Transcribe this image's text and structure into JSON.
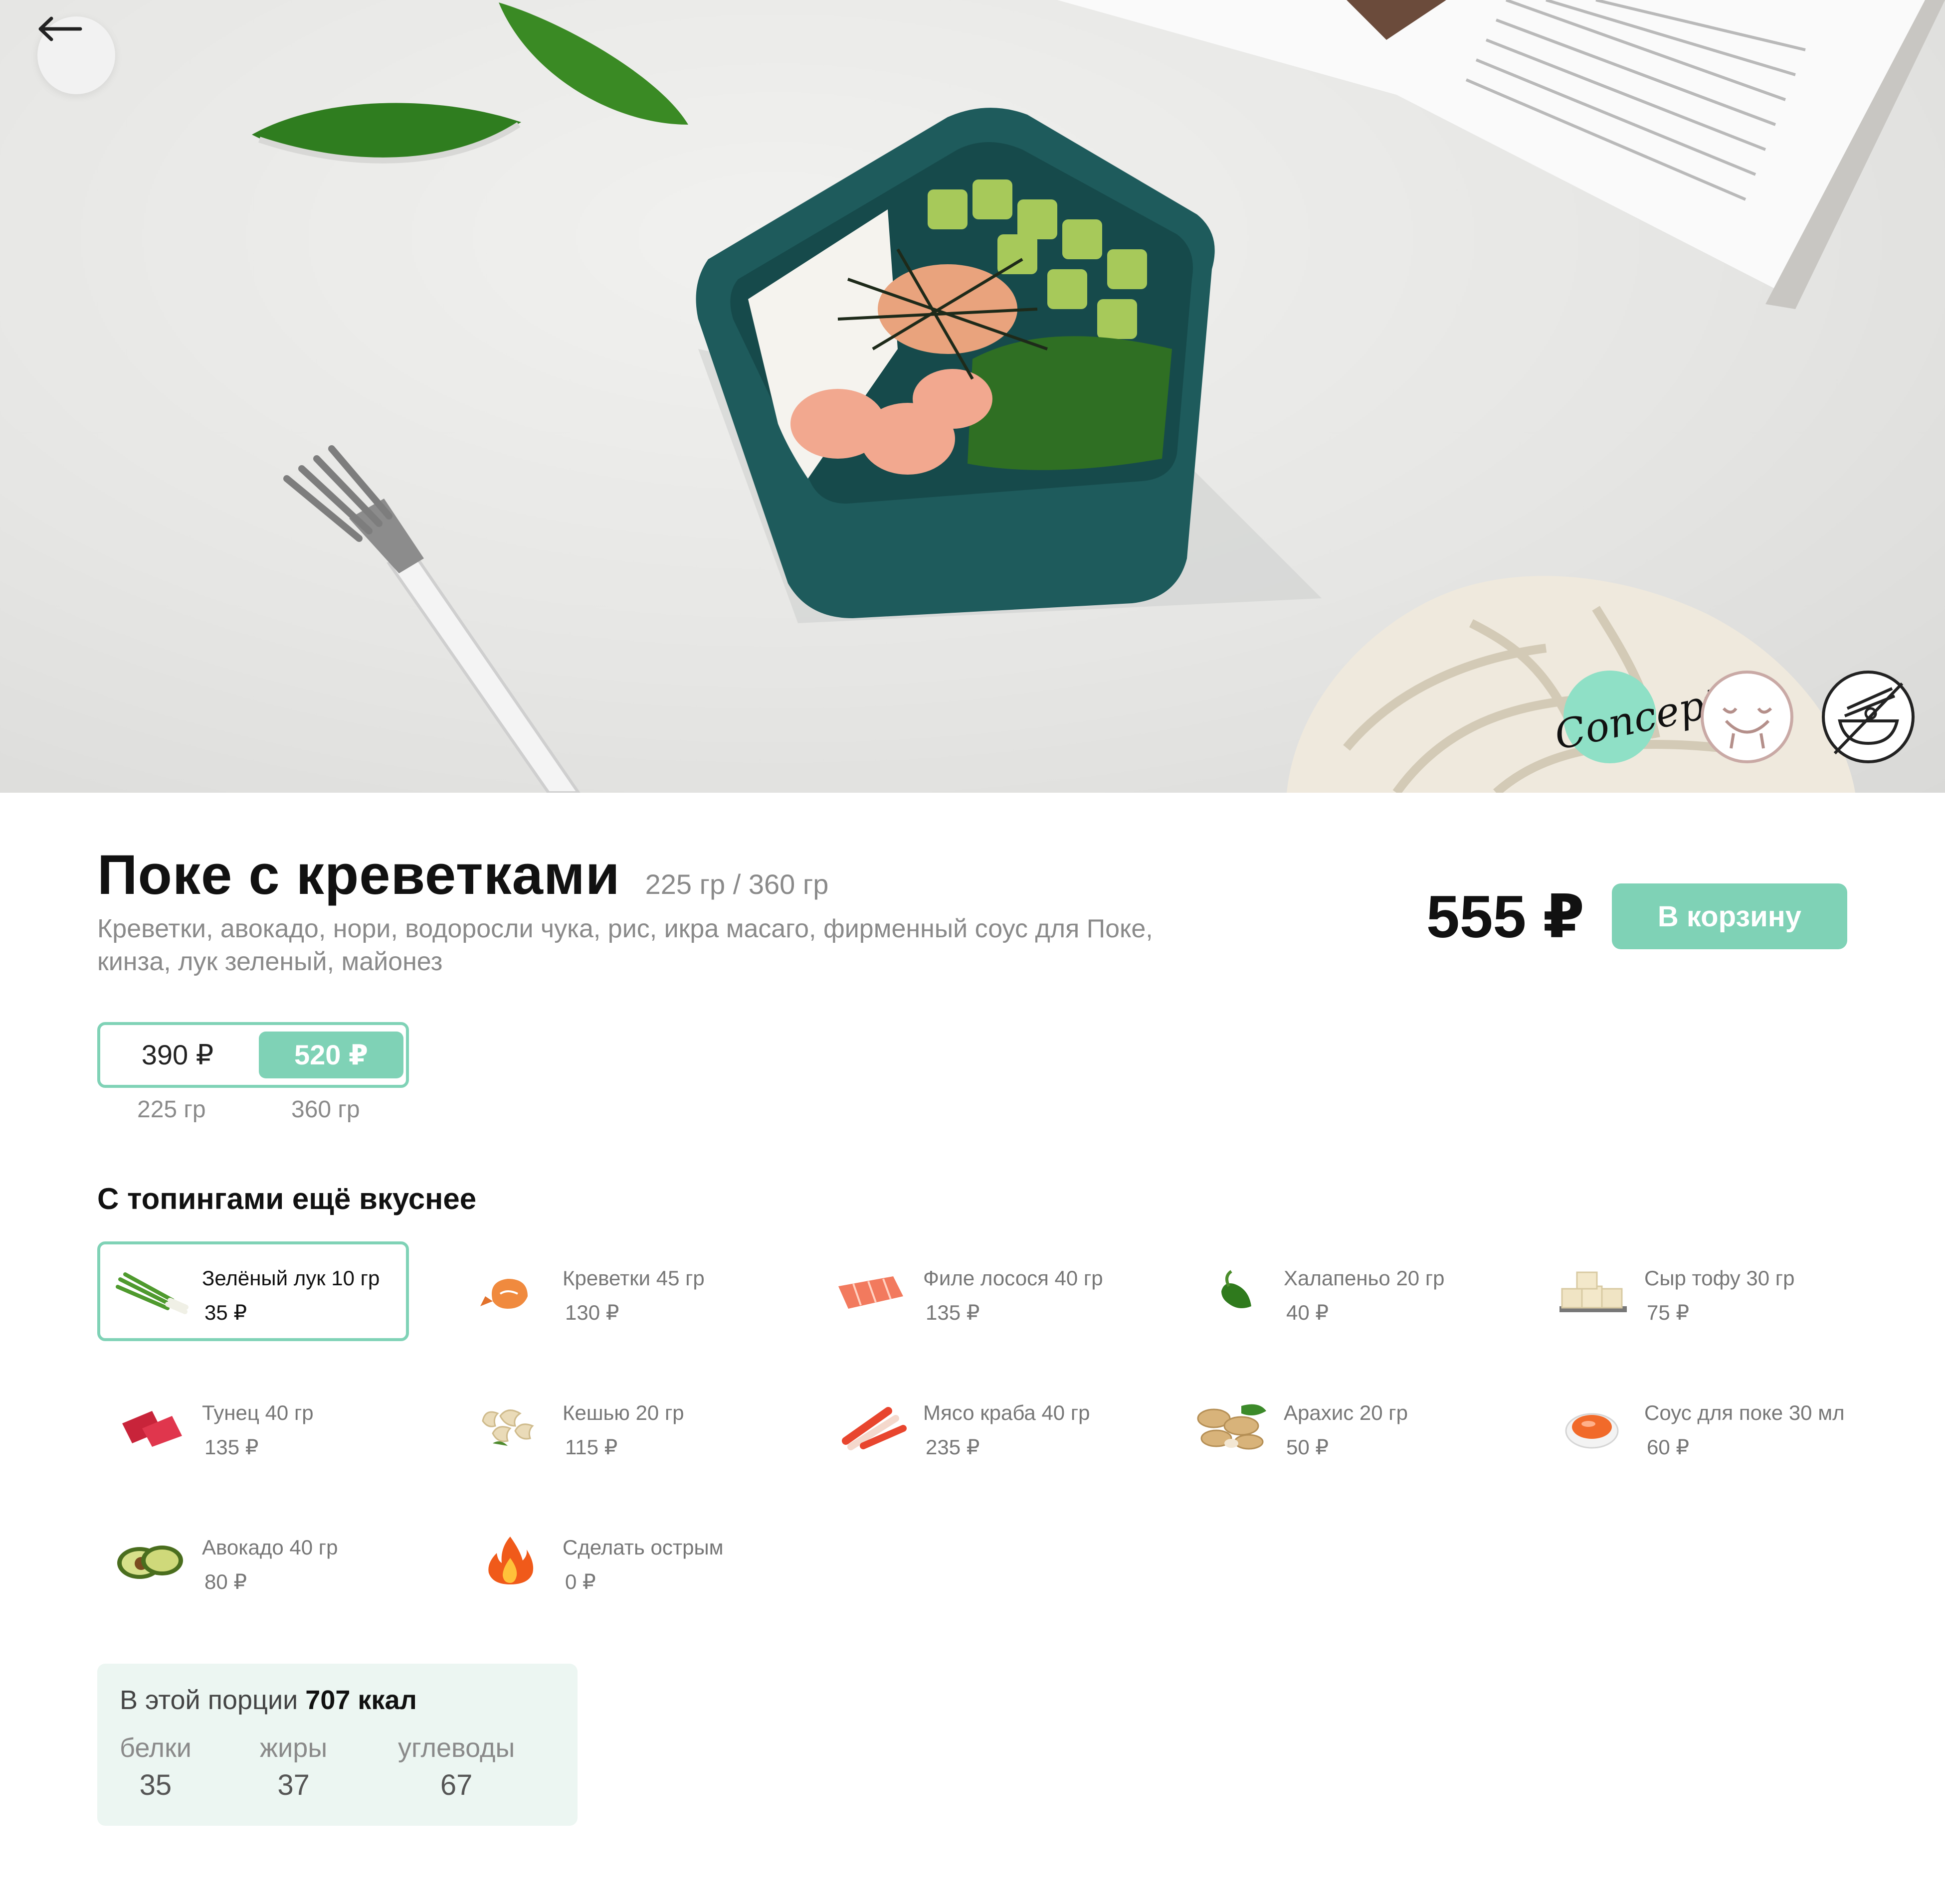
{
  "hero": {
    "badges": [
      {
        "name": "concept",
        "text": "Concept",
        "color": "#8fe0c6"
      },
      {
        "name": "face-icon"
      },
      {
        "name": "bowl-icon"
      }
    ]
  },
  "product": {
    "title": "Поке с креветками",
    "weights": "225 гр / 360 гр",
    "description": "Креветки, авокадо, нори, водоросли чука, рис, икра масаго, фирменный соус для Поке, кинза, лук зеленый, майонез",
    "price": "555 ₽",
    "cart_label": "В корзину"
  },
  "sizes": [
    {
      "price": "390 ₽",
      "weight": "225 гр",
      "selected": false
    },
    {
      "price": "520 ₽",
      "weight": "360 гр",
      "selected": true
    }
  ],
  "toppings_title": "С топингами ещё вкуснее",
  "toppings": [
    {
      "name": "Зелёный лук 10 гр",
      "price": "35 ₽",
      "icon": "green-onion-icon",
      "selected": true
    },
    {
      "name": "Креветки 45 гр",
      "price": "130 ₽",
      "icon": "shrimp-icon"
    },
    {
      "name": "Филе лосося 40 гр",
      "price": "135 ₽",
      "icon": "salmon-icon"
    },
    {
      "name": "Халапеньо 20 гр",
      "price": "40 ₽",
      "icon": "jalapeno-icon"
    },
    {
      "name": "Сыр тофу 30 гр",
      "price": "75 ₽",
      "icon": "tofu-icon"
    },
    {
      "name": "Тунец 40 гр",
      "price": "135 ₽",
      "icon": "tuna-icon"
    },
    {
      "name": "Кешью 20 гр",
      "price": "115 ₽",
      "icon": "cashew-icon"
    },
    {
      "name": "Мясо краба 40 гр",
      "price": "235 ₽",
      "icon": "crab-meat-icon"
    },
    {
      "name": "Арахис 20 гр",
      "price": "50 ₽",
      "icon": "peanut-icon"
    },
    {
      "name": "Соус для поке 30 мл",
      "price": "60 ₽",
      "icon": "sauce-icon"
    },
    {
      "name": "Авокадо 40 гр",
      "price": "80 ₽",
      "icon": "avocado-icon"
    },
    {
      "name": "Сделать острым",
      "price": "0 ₽",
      "icon": "fire-icon"
    }
  ],
  "nutrition": {
    "prefix": "В этой порции",
    "kcal": "707 ккал",
    "items": [
      {
        "label": "белки",
        "value": "35"
      },
      {
        "label": "жиры",
        "value": "37"
      },
      {
        "label": "углеводы",
        "value": "67"
      }
    ]
  },
  "colors": {
    "accent": "#7fd2b6",
    "nutrition_bg": "#ecf6f2",
    "bowl": "#1e5b5c"
  }
}
